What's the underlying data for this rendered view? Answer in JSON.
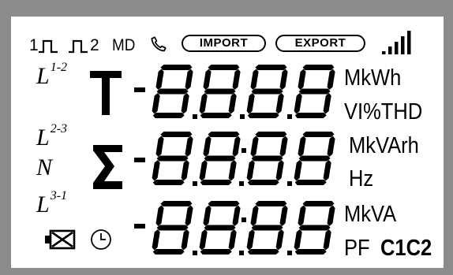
{
  "indicators": {
    "pulse1": "1",
    "pulse2": "2",
    "md": "MD",
    "import": "IMPORT",
    "export": "EXPORT"
  },
  "phase_labels": {
    "l12": {
      "base": "L",
      "sup": "1-2"
    },
    "l23": {
      "base": "L",
      "sup": "2-3"
    },
    "n": "N",
    "l31": {
      "base": "L",
      "sup": "3-1"
    }
  },
  "row_symbols": {
    "total": "T",
    "sum": "Σ"
  },
  "rows": [
    {
      "sign": "-",
      "digits": "8.8.8.8"
    },
    {
      "sign": "-",
      "digits": "8.8:8.8"
    },
    {
      "sign": "-",
      "digits": "8.8:8.8"
    }
  ],
  "units": {
    "mkwh": "MkWh",
    "vi_thd": "VI%THD",
    "mkvarh": "MkVArh",
    "hz": "Hz",
    "mkva": "MkVA",
    "pf": "PF",
    "c1c2": "C1C2"
  },
  "icons": [
    "pulse-icon",
    "phone-icon",
    "signal-bars-icon",
    "battery-crossed-icon",
    "clock-icon"
  ],
  "colors": {
    "bezel": "#8c8c8c",
    "segment": "#000000",
    "background": "#ffffff"
  }
}
